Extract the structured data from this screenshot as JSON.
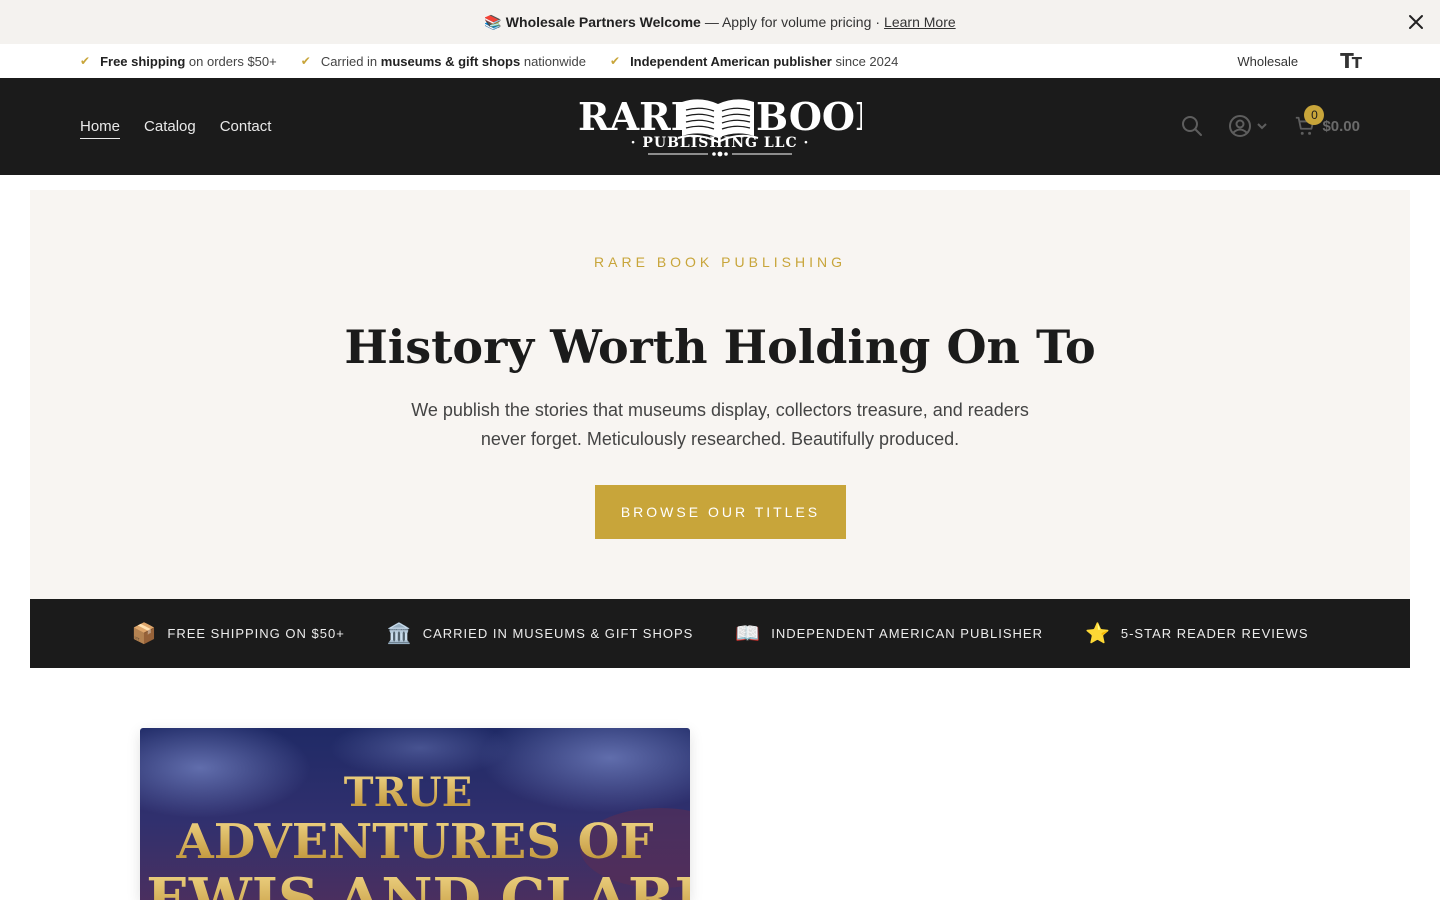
{
  "announcement": {
    "emoji": "📚",
    "strong": "Wholesale Partners Welcome",
    "text": "— Apply for volume pricing",
    "sep": "·",
    "link": "Learn More",
    "close_icon": "close-icon"
  },
  "trust": {
    "items": [
      {
        "bold": "Free shipping",
        "rest": "on orders $50+"
      },
      {
        "pre": "Carried in",
        "bold": "museums & gift shops",
        "rest": "nationwide"
      },
      {
        "bold": "Independent American publisher",
        "rest": "since 2024"
      }
    ],
    "wholesale": "Wholesale",
    "text_size_icon": "text-size-icon"
  },
  "header": {
    "nav": [
      "Home",
      "Catalog",
      "Contact"
    ],
    "logo": {
      "line1a": "RARE",
      "line1b": "BOOK",
      "line2": "· PUBLISHING LLC ·"
    },
    "cart": {
      "count": "0",
      "amount": "$0.00"
    },
    "icons": [
      "search-icon",
      "account-icon",
      "chevron-down-icon",
      "cart-icon"
    ]
  },
  "hero": {
    "eyebrow": "RARE BOOK PUBLISHING",
    "title": "History Worth Holding On To",
    "subtitle": "We publish the stories that museums display, collectors treasure, and readers never forget. Meticulously researched. Beautifully produced.",
    "cta": "BROWSE OUR TITLES"
  },
  "features": [
    {
      "emoji": "📦",
      "label": "FREE SHIPPING ON $50+"
    },
    {
      "emoji": "🏛️",
      "label": "CARRIED IN MUSEUMS & GIFT SHOPS"
    },
    {
      "emoji": "📖",
      "label": "INDEPENDENT AMERICAN PUBLISHER"
    },
    {
      "emoji": "⭐",
      "label": "5-STAR READER REVIEWS"
    }
  ],
  "product": {
    "cover_line1": "TRUE",
    "cover_line2": "ADVENTURES OF",
    "cover_line3": "LEWIS AND CLARK"
  },
  "colors": {
    "accent": "#c8a53a",
    "dark": "#1b1b1b",
    "hero_bg": "#f8f5f2"
  }
}
